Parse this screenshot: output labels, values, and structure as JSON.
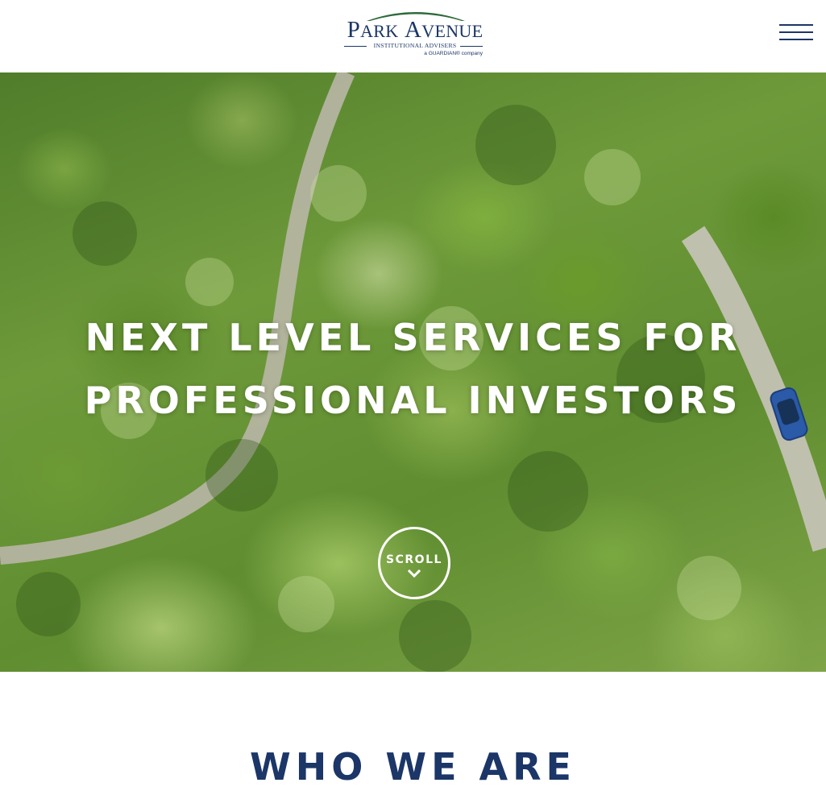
{
  "header": {
    "logo": {
      "brand_first": "P",
      "brand_first_rest": "ARK",
      "brand_second": "A",
      "brand_second_rest": "VENUE",
      "subtitle": "INSTITUTIONAL ADVISERS",
      "tagline": "a GUARDIAN® company",
      "arch_color": "#2d6a3a",
      "text_color": "#1b3667"
    },
    "menu_icon": "hamburger-menu-icon"
  },
  "hero": {
    "title_line1": "NEXT LEVEL SERVICES FOR",
    "title_line2": "PROFESSIONAL INVESTORS",
    "scroll_label": "SCROLL",
    "scroll_icon": "chevron-down-icon"
  },
  "about": {
    "title": "WHO WE ARE"
  },
  "colors": {
    "brand_navy": "#1b3667",
    "hero_text": "#ffffff"
  }
}
